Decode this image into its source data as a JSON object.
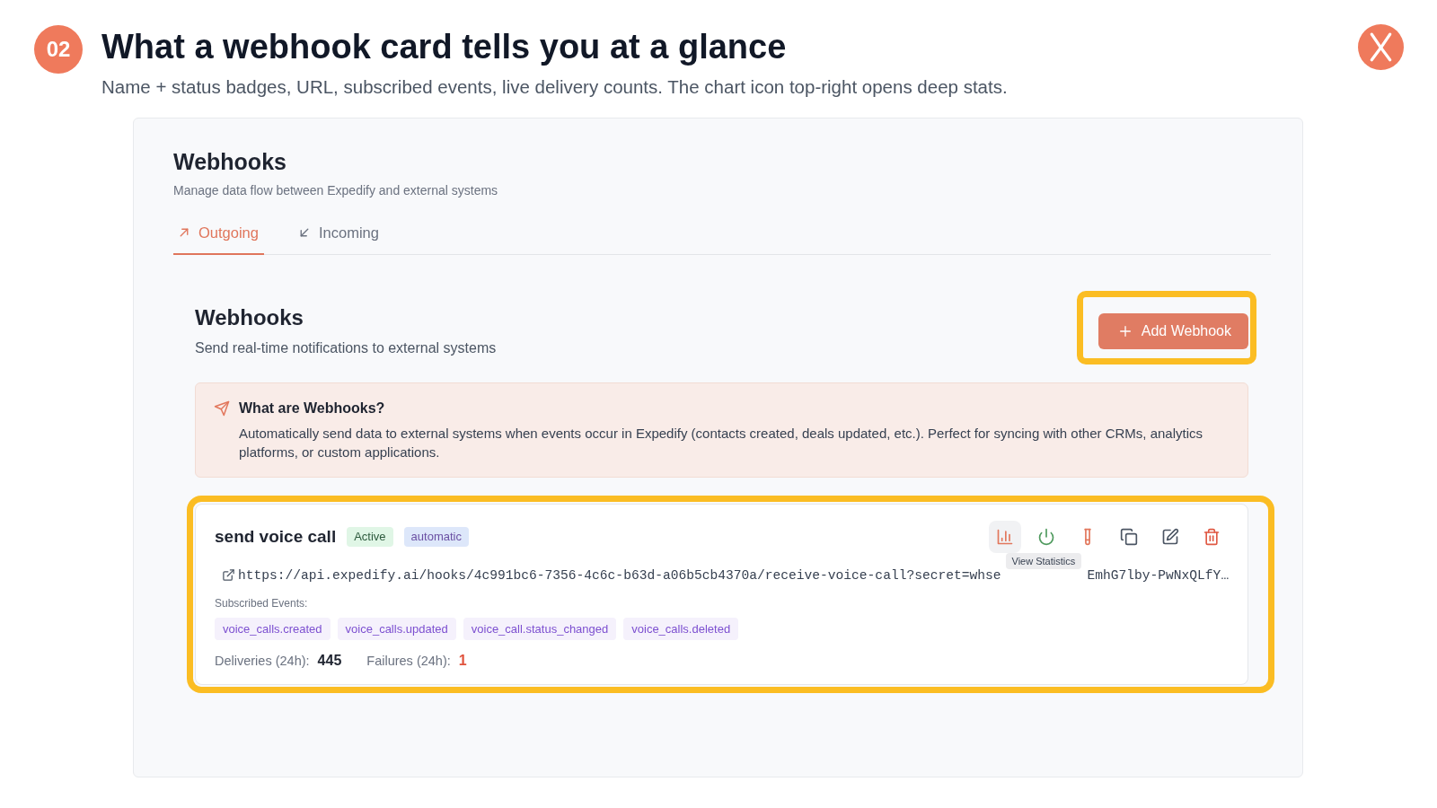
{
  "slide": {
    "number": "02",
    "title": "What a webhook card tells you at a glance",
    "subtitle": "Name + status badges, URL, subscribed events, live delivery counts. The chart icon top-right opens deep stats."
  },
  "app": {
    "title": "Webhooks",
    "subtitle": "Manage data flow between Expedify and external systems",
    "tabs": [
      {
        "label": "Outgoing",
        "kind": "outgoing",
        "selected": true
      },
      {
        "label": "Incoming",
        "kind": "incoming",
        "selected": false
      }
    ],
    "section": {
      "title": "Webhooks",
      "subtitle": "Send real-time notifications to external systems",
      "add_button": {
        "label": "Add Webhook",
        "highlighted": true
      }
    },
    "info": {
      "title": "What are Webhooks?",
      "text": "Automatically send data to external systems when events occur in Expedify (contacts created, deals updated, etc.). Perfect for syncing with other CRMs, analytics platforms, or custom applications."
    },
    "webhooks": [
      {
        "name": "send voice call",
        "highlighted": true,
        "badges": [
          {
            "label": "Active",
            "kind": "status"
          },
          {
            "label": "automatic",
            "kind": "mode"
          }
        ],
        "actions": [
          {
            "kind": "stats",
            "hovered": true,
            "tooltip": "View Statistics"
          },
          {
            "kind": "toggle",
            "hovered": false
          },
          {
            "kind": "test",
            "hovered": false
          },
          {
            "kind": "duplicate",
            "hovered": false
          },
          {
            "kind": "edit",
            "hovered": false
          },
          {
            "kind": "delete",
            "hovered": false
          }
        ],
        "url_visible": [
          "https://api.expedify.ai/hooks/4c991bc6-7356-4c6c-b63d-a06b5cb4370a/receive-voice-call?secret=whse",
          "EmhG7lby-PwNxQLfY…"
        ],
        "events_label": "Subscribed Events:",
        "events": [
          "voice_calls.created",
          "voice_calls.updated",
          "voice_call.status_changed",
          "voice_calls.deleted"
        ],
        "stats": [
          {
            "label": "Deliveries (24h):",
            "value": "445",
            "kind": "count"
          },
          {
            "label": "Failures (24h):",
            "value": "1",
            "kind": "failure"
          }
        ]
      }
    ]
  }
}
